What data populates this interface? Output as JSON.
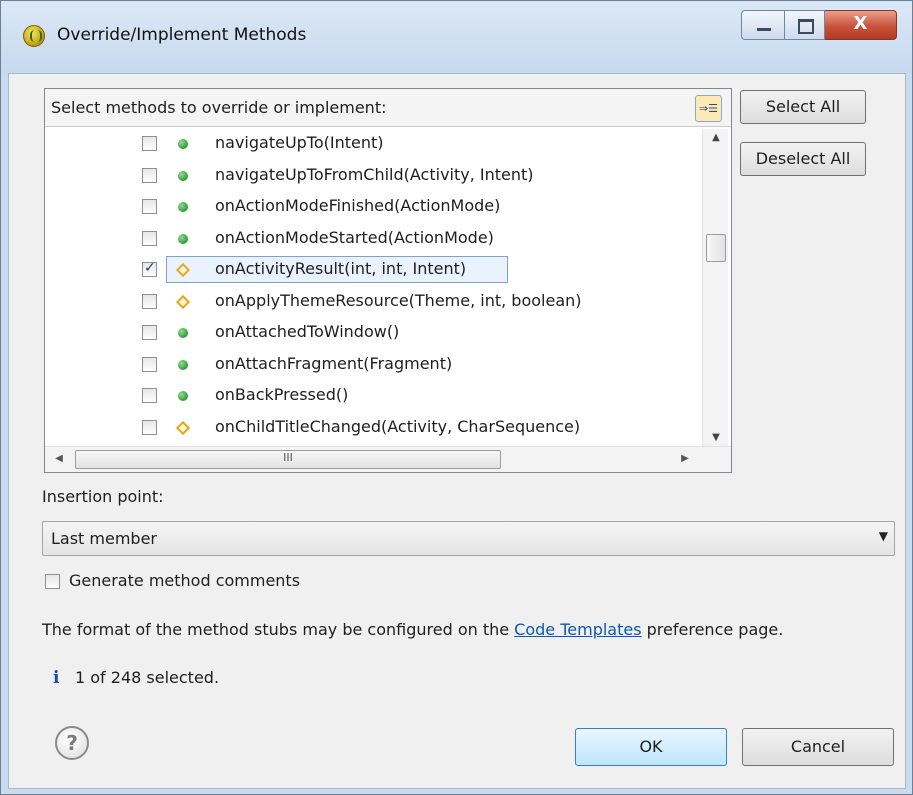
{
  "window": {
    "title": "Override/Implement Methods",
    "close_glyph": "X"
  },
  "methods_panel": {
    "header_label": "Select methods to override or implement:",
    "rows": [
      {
        "label": "navigateUpTo(Intent)",
        "kind": "green-dot",
        "checked": false
      },
      {
        "label": "navigateUpToFromChild(Activity, Intent)",
        "kind": "green-dot",
        "checked": false
      },
      {
        "label": "onActionModeFinished(ActionMode)",
        "kind": "green-dot",
        "checked": false
      },
      {
        "label": "onActionModeStarted(ActionMode)",
        "kind": "green-dot",
        "checked": false
      },
      {
        "label": "onActivityResult(int, int, Intent)",
        "kind": "yellow-diamond",
        "checked": true,
        "selected": true
      },
      {
        "label": "onApplyThemeResource(Theme, int, boolean)",
        "kind": "yellow-diamond",
        "checked": false
      },
      {
        "label": "onAttachedToWindow()",
        "kind": "green-dot",
        "checked": false
      },
      {
        "label": "onAttachFragment(Fragment)",
        "kind": "green-dot",
        "checked": false
      },
      {
        "label": "onBackPressed()",
        "kind": "green-dot",
        "checked": false
      },
      {
        "label": "onChildTitleChanged(Activity, CharSequence)",
        "kind": "yellow-diamond",
        "checked": false
      }
    ],
    "hscroll_grip": "III"
  },
  "buttons": {
    "select_all": "Select All",
    "deselect_all": "Deselect All",
    "ok": "OK",
    "cancel": "Cancel"
  },
  "insertion_point": {
    "label": "Insertion point:",
    "value": "Last member"
  },
  "generate_comments": {
    "label": "Generate method comments",
    "checked": false
  },
  "info": {
    "text_before": "The format of the method stubs may be configured on the ",
    "link_text": "Code Templates",
    "text_after": " preference page."
  },
  "status": {
    "icon": "i",
    "text": "1 of 248 selected."
  },
  "help": {
    "glyph": "?"
  },
  "colors": {
    "title_bar": "#c9dbee",
    "close_button": "#c9523a",
    "link": "#0b57b5",
    "method_public": "#2f9a3a",
    "method_protected": "#e3a825"
  }
}
